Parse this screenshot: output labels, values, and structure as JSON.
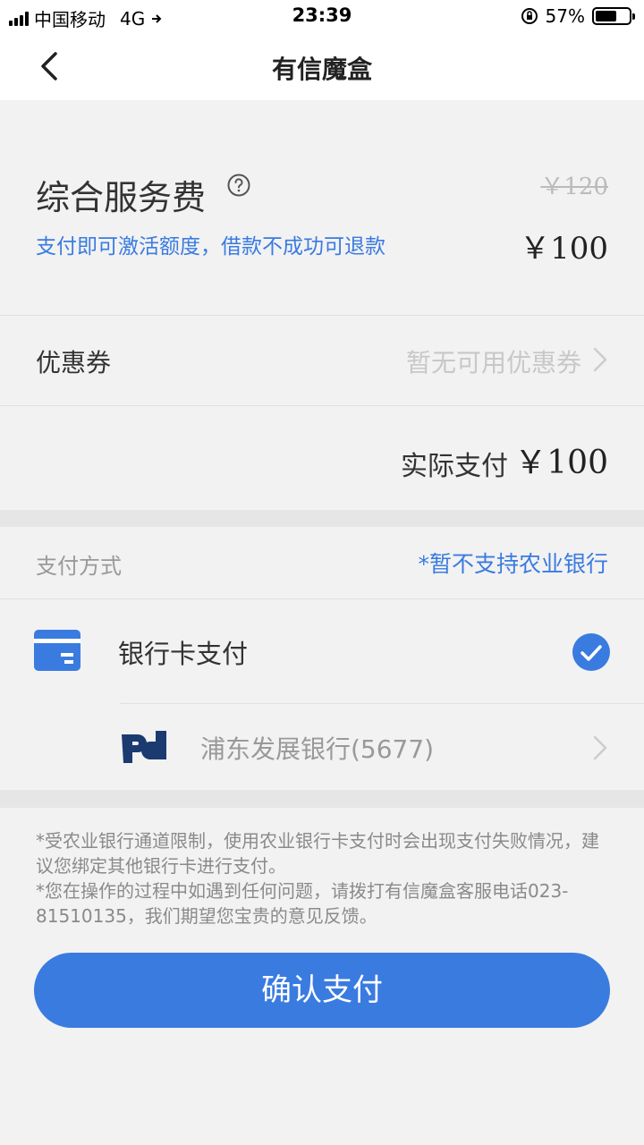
{
  "status_bar": {
    "carrier": "中国移动",
    "network": "4G",
    "time": "23:39",
    "battery": "57%"
  },
  "nav": {
    "title": "有信魔盒"
  },
  "fee": {
    "title": "综合服务费",
    "note": "支付即可激活额度，借款不成功可退款",
    "original_price": "￥120",
    "price": "￥100"
  },
  "coupon": {
    "label": "优惠券",
    "value": "暂无可用优惠券"
  },
  "actual": {
    "label": "实际支付",
    "price": "￥100"
  },
  "payment": {
    "section_label": "支付方式",
    "note": "*暂不支持农业银行",
    "method_label": "银行卡支付",
    "bank_label": "浦东发展银行(5677)"
  },
  "notes": {
    "line1": "*受农业银行通道限制，使用农业银行卡支付时会出现支付失败情况，建议您绑定其他银行卡进行支付。",
    "line2": "*您在操作的过程中如遇到任何问题，请拨打有信魔盒客服电话023-81510135，我们期望您宝贵的意见反馈。"
  },
  "confirm_button": "确认支付",
  "colors": {
    "accent": "#3a7be0",
    "bank_logo": "#1b3a70"
  },
  "icons": {
    "back": "chevron-left-icon",
    "help": "question-circle-icon",
    "coupon_arrow": "chevron-right-icon",
    "card": "credit-card-icon",
    "selected": "check-circle-icon",
    "bank_logo": "spdb-logo-icon",
    "bank_arrow": "chevron-right-icon"
  }
}
